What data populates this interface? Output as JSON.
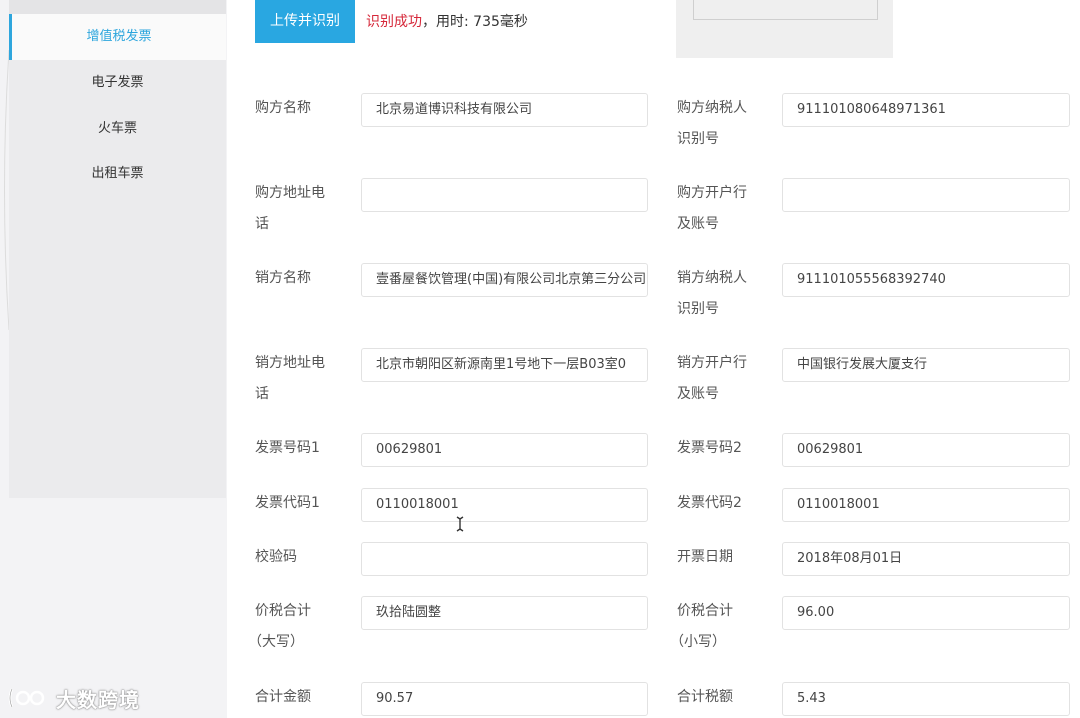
{
  "sidebar": {
    "items": [
      {
        "label": "增值税发票",
        "active": true
      },
      {
        "label": "电子发票",
        "active": false
      },
      {
        "label": "火车票",
        "active": false
      },
      {
        "label": "出租车票",
        "active": false
      }
    ]
  },
  "toolbar": {
    "upload_label": "上传并识别",
    "status_success": "识别成功",
    "status_time": "，用时: 735毫秒"
  },
  "form": {
    "buyer_name": {
      "label": "购方名称",
      "value": "北京易道博识科技有限公司"
    },
    "buyer_tax_id": {
      "label_1": "购方纳税人",
      "label_2": "识别号",
      "value": "911101080648971361"
    },
    "buyer_address": {
      "label_1": "购方地址电",
      "label_2": "话",
      "value": ""
    },
    "buyer_bank": {
      "label_1": "购方开户行",
      "label_2": "及账号",
      "value": ""
    },
    "seller_name": {
      "label": "销方名称",
      "value": "壹番屋餐饮管理(中国)有限公司北京第三分公司"
    },
    "seller_tax_id": {
      "label_1": "销方纳税人",
      "label_2": "识别号",
      "value": "911101055568392740"
    },
    "seller_address": {
      "label_1": "销方地址电",
      "label_2": "话",
      "value": "北京市朝阳区新源南里1号地下一层B03室0"
    },
    "seller_bank": {
      "label_1": "销方开户行",
      "label_2": "及账号",
      "value": "中国银行发展大厦支行"
    },
    "invoice_no_1": {
      "label": "发票号码1",
      "value": "00629801"
    },
    "invoice_no_2": {
      "label": "发票号码2",
      "value": "00629801"
    },
    "invoice_code_1": {
      "label": "发票代码1",
      "value": "0110018001"
    },
    "invoice_code_2": {
      "label": "发票代码2",
      "value": "0110018001"
    },
    "check_code": {
      "label": "校验码",
      "value": ""
    },
    "issue_date": {
      "label": "开票日期",
      "value": "2018年08月01日"
    },
    "total_upper": {
      "label_1": "价税合计",
      "label_2": "（大写）",
      "value": "玖拾陆圆整"
    },
    "total_lower": {
      "label_1": "价税合计",
      "label_2": "（小写）",
      "value": "96.00"
    },
    "total_amount": {
      "label": "合计金额",
      "value": "90.57"
    },
    "total_tax": {
      "label": "合计税额",
      "value": "5.43"
    }
  },
  "watermark": {
    "text": "大数跨境"
  },
  "colors": {
    "accent": "#29a7e1",
    "success": "#d6283a"
  }
}
